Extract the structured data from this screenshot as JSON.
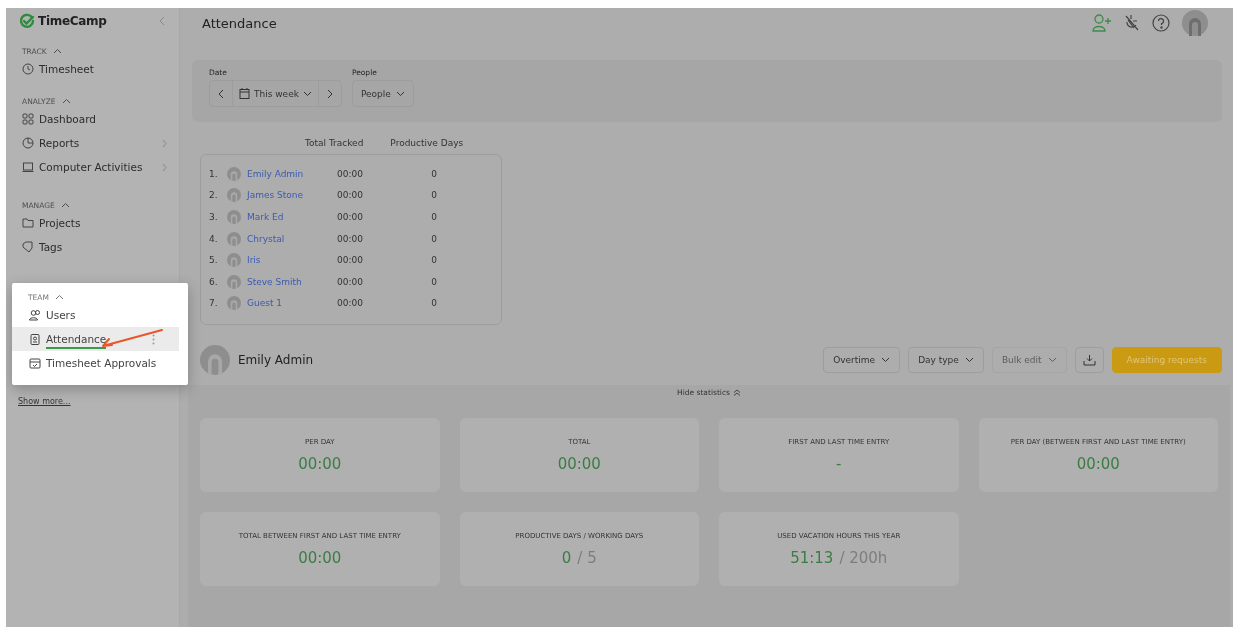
{
  "brand": "TimeCamp",
  "page_title": "Attendance",
  "sidebar": {
    "sections": [
      {
        "title": "TRACK",
        "expanded": true,
        "highlighted": false,
        "items": [
          {
            "label": "Timesheet",
            "submenu": false,
            "selected": false
          }
        ]
      },
      {
        "title": "ANALYZE",
        "expanded": true,
        "highlighted": false,
        "items": [
          {
            "label": "Dashboard",
            "submenu": false,
            "selected": false
          },
          {
            "label": "Reports",
            "submenu": true,
            "selected": false
          },
          {
            "label": "Computer Activities",
            "submenu": true,
            "selected": false
          }
        ]
      },
      {
        "title": "MANAGE",
        "expanded": true,
        "highlighted": false,
        "items": [
          {
            "label": "Projects",
            "submenu": false,
            "selected": false
          },
          {
            "label": "Tags",
            "submenu": false,
            "selected": false
          }
        ]
      },
      {
        "title": "TEAM",
        "expanded": true,
        "highlighted": true,
        "items": [
          {
            "label": "Users",
            "submenu": false,
            "selected": false
          },
          {
            "label": "Attendance",
            "submenu": false,
            "selected": true
          },
          {
            "label": "Timesheet Approvals",
            "submenu": false,
            "selected": false
          }
        ]
      }
    ],
    "show_more": "Show more..."
  },
  "filters": {
    "date_label": "Date",
    "date_value": "This week",
    "people_label": "People",
    "people_value": "People"
  },
  "table": {
    "columns": [
      "Total Tracked",
      "Productive Days"
    ],
    "rows": [
      {
        "index": "1.",
        "name": "Emily Admin",
        "tracked": "00:00",
        "days": "0"
      },
      {
        "index": "2.",
        "name": "James Stone",
        "tracked": "00:00",
        "days": "0"
      },
      {
        "index": "3.",
        "name": "Mark Ed",
        "tracked": "00:00",
        "days": "0"
      },
      {
        "index": "4.",
        "name": "Chrystal",
        "tracked": "00:00",
        "days": "0"
      },
      {
        "index": "5.",
        "name": "Iris",
        "tracked": "00:00",
        "days": "0"
      },
      {
        "index": "6.",
        "name": "Steve Smith",
        "tracked": "00:00",
        "days": "0"
      },
      {
        "index": "7.",
        "name": "Guest 1",
        "tracked": "00:00",
        "days": "0"
      }
    ]
  },
  "user": {
    "name": "Emily Admin"
  },
  "actions": [
    {
      "label": "Overtime",
      "kind": "dropdown",
      "disabled": false
    },
    {
      "label": "Day type",
      "kind": "dropdown",
      "disabled": false
    },
    {
      "label": "Bulk edit",
      "kind": "dropdown",
      "disabled": true
    },
    {
      "kind": "export",
      "disabled": false
    },
    {
      "label": "Awaiting requests",
      "kind": "primary",
      "disabled": false
    }
  ],
  "stats": {
    "toggle": "Hide statistics",
    "cards": [
      {
        "label": "PER DAY",
        "value": "00:00"
      },
      {
        "label": "TOTAL",
        "value": "00:00"
      },
      {
        "label": "FIRST AND LAST TIME ENTRY",
        "value": "-"
      },
      {
        "label": "PER DAY (BETWEEN FIRST AND LAST TIME ENTRY)",
        "value": "00:00"
      },
      {
        "label": "TOTAL BETWEEN FIRST AND LAST TIME ENTRY",
        "value": "00:00"
      },
      {
        "label": "PRODUCTIVE DAYS / WORKING DAYS",
        "value": "0",
        "total": "/ 5"
      },
      {
        "label": "USED VACATION HOURS THIS YEAR",
        "value": "51:13",
        "total": "/ 200h"
      }
    ]
  }
}
